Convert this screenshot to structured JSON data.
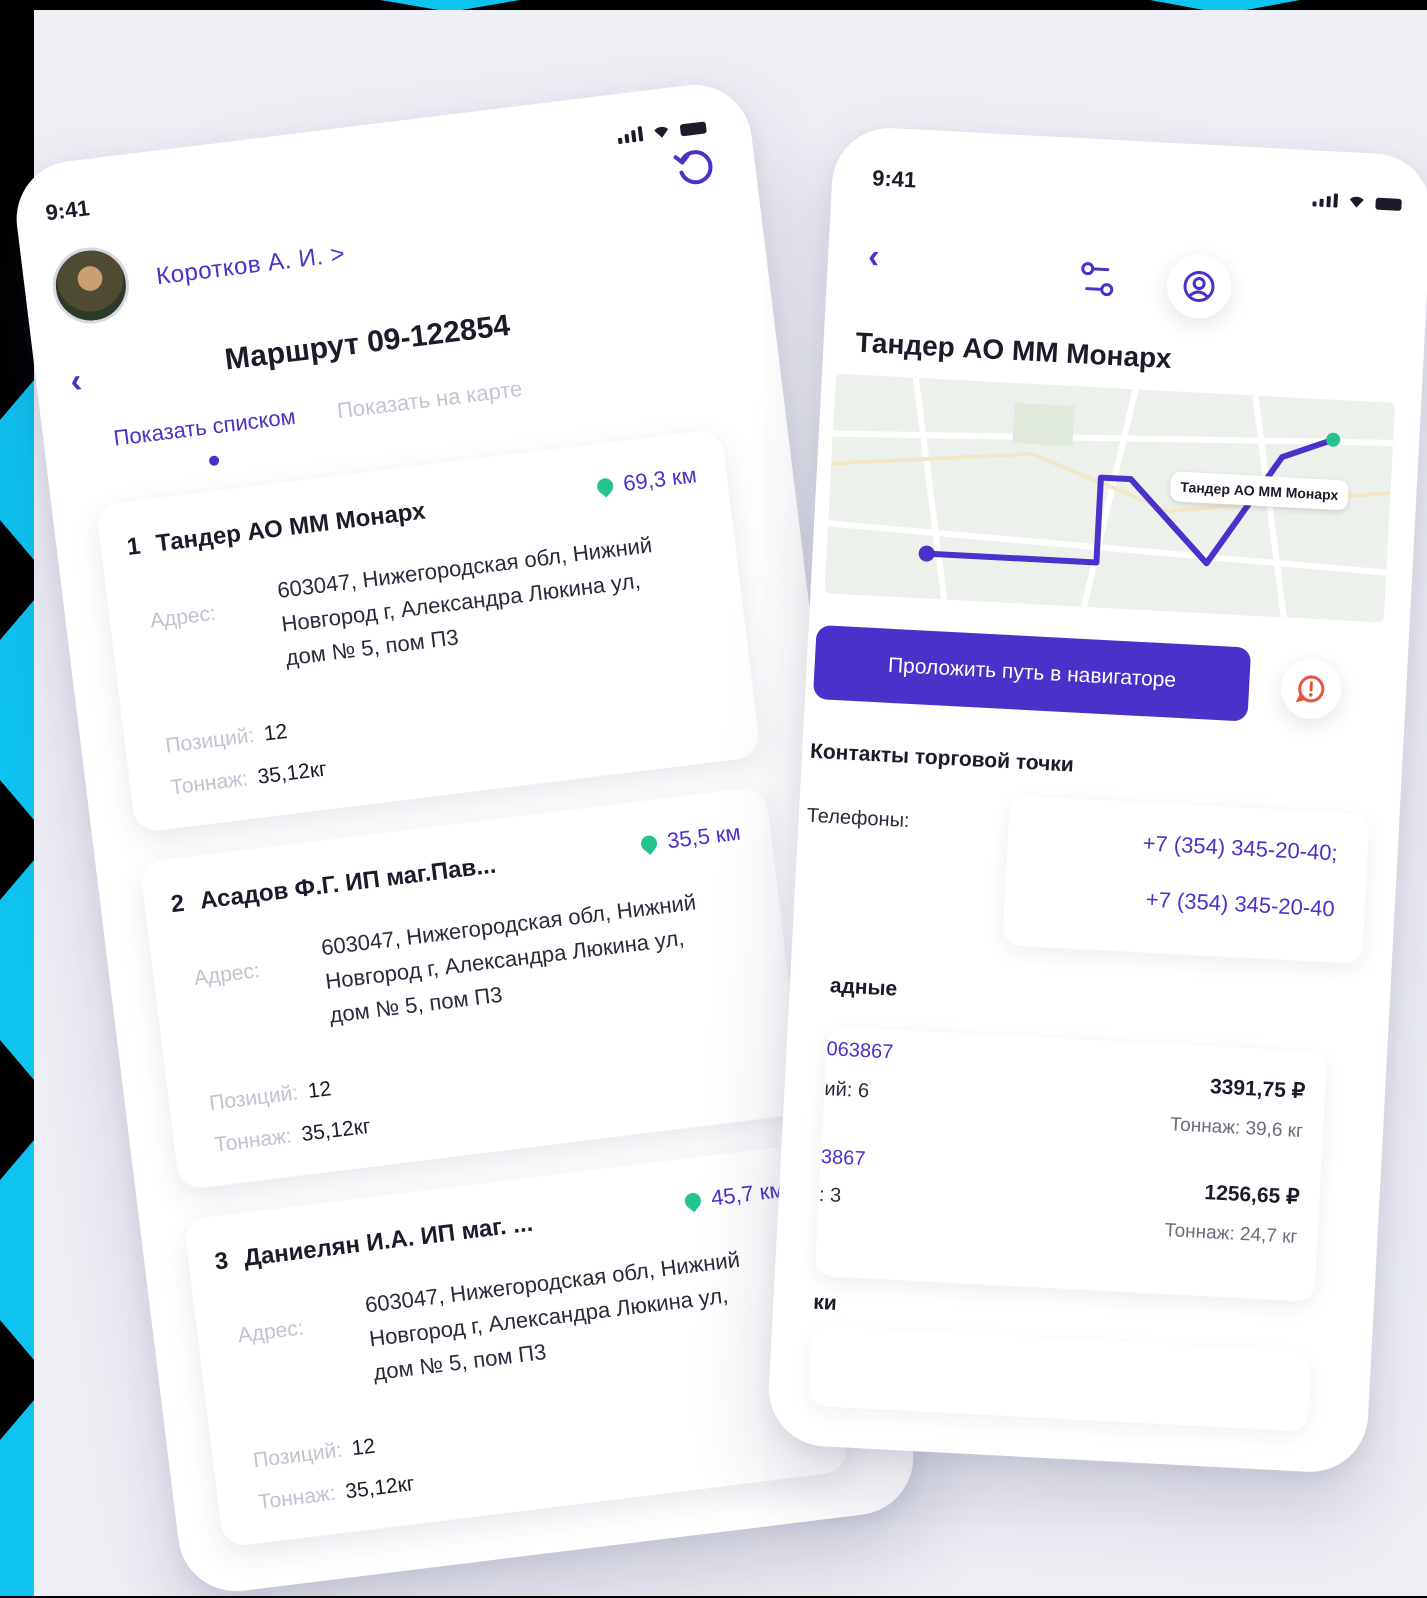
{
  "colors": {
    "accent": "#4a31c9",
    "green_pin": "#22c38e",
    "background": "#eeeff5",
    "side_blue": "#0fc3f0"
  },
  "left_phone": {
    "status_time": "9:41",
    "user_name": "Коротков А. И.  >",
    "route_title": "Маршрут 09-122854",
    "tabs": [
      {
        "label": "Показать списком",
        "active": true
      },
      {
        "label": "Показать на карте",
        "active": false
      }
    ],
    "cards": [
      {
        "index": "1",
        "name": "Тандер АО ММ Монарх",
        "distance": "69,3 км",
        "address_label": "Адрес:",
        "address": "603047, Нижегородская обл, Нижний Новгород г, Александра Люкина ул, дом № 5, пом П3",
        "positions_label": "Позиций:",
        "positions": "12",
        "tonnage_label": "Тоннаж:",
        "tonnage": "35,12кг"
      },
      {
        "index": "2",
        "name": "Асадов Ф.Г. ИП маг.Пав...",
        "distance": "35,5 км",
        "address_label": "Адрес:",
        "address": "603047, Нижегородская обл, Нижний Новгород г, Александра Люкина ул, дом № 5, пом П3",
        "positions_label": "Позиций:",
        "positions": "12",
        "tonnage_label": "Тоннаж:",
        "tonnage": "35,12кг"
      },
      {
        "index": "3",
        "name": "Даниелян И.А. ИП маг. ...",
        "distance": "45,7 км",
        "address_label": "Адрес:",
        "address": "603047, Нижегородская обл, Нижний Новгород г, Александра Люкина ул, дом № 5, пом П3",
        "positions_label": "Позиций:",
        "positions": "12",
        "tonnage_label": "Тоннаж:",
        "tonnage": "35,12кг"
      }
    ]
  },
  "right_phone": {
    "status_time": "9:41",
    "shop_title": "Тандер АО ММ Монарх",
    "map_label": "Тандер АО ММ Монарх",
    "nav_button": "Проложить путь в навигаторе",
    "contacts_title": "Контакты торговой точки",
    "phones_label": "Телефоны:",
    "phones": [
      "+7 (354) 345-20-40;",
      "+7 (354) 345-20-40"
    ],
    "invoices_title": "адные",
    "invoices": [
      {
        "id": "063867",
        "count": "ий: 6",
        "amount": "3391,75 ₽",
        "tonnage": "Тоннаж: 39,6 кг"
      },
      {
        "id": "3867",
        "count": ": 3",
        "amount": "1256,65 ₽",
        "tonnage": "Тоннаж: 24,7 кг"
      }
    ],
    "last_section_title": "ки"
  }
}
